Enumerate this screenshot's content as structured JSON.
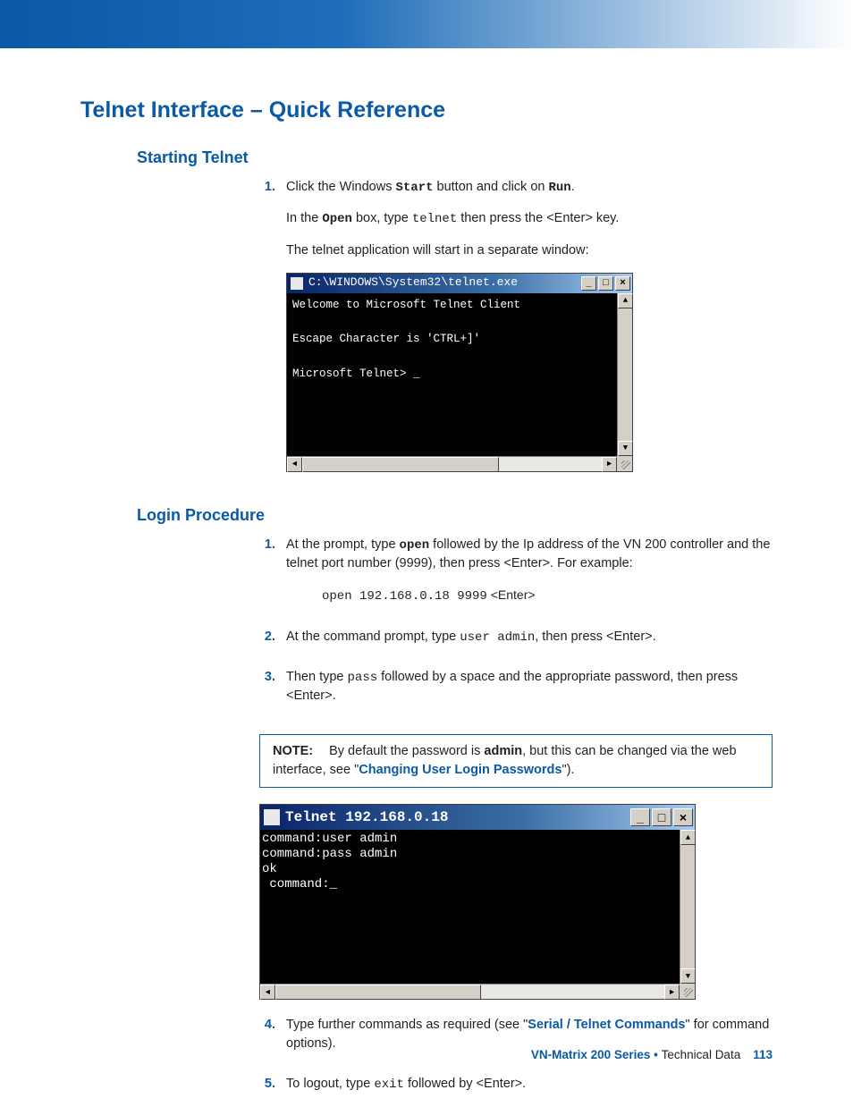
{
  "h1": "Telnet Interface – Quick Reference",
  "sec1": {
    "heading": "Starting Telnet",
    "step1": {
      "num": "1.",
      "t1": "Click the Windows ",
      "start": "Start",
      "t2": " button and click on ",
      "run": "Run",
      "t3": ".",
      "p2a": "In the ",
      "open": "Open",
      "p2b": " box, type ",
      "telnet": "telnet",
      "p2c": " then press the <Enter> key.",
      "p3": "The telnet application will start in a separate window:"
    }
  },
  "console1": {
    "title": "C:\\WINDOWS\\System32\\telnet.exe",
    "body": "Welcome to Microsoft Telnet Client\n\nEscape Character is 'CTRL+]'\n\nMicrosoft Telnet> _\n\n\n\n\n"
  },
  "sec2": {
    "heading": "Login Procedure",
    "s1": {
      "num": "1.",
      "a": "At the prompt, type ",
      "open": "open",
      "b": " followed by the Ip address of the VN 200 controller and the telnet port number (9999), then press <Enter>. For example:",
      "code": "open 192.168.0.18 9999",
      "enter": " <Enter>"
    },
    "s2": {
      "num": "2.",
      "a": "At the command prompt, type ",
      "cmd": "user admin",
      "b": ", then press <Enter>."
    },
    "s3": {
      "num": "3.",
      "a": "Then type ",
      "pass": "pass",
      "b": " followed by a space and the appropriate password, then press <Enter>."
    },
    "note": {
      "label": "NOTE:",
      "a": "By default the password is ",
      "admin": "admin",
      "b": ", but this can be changed via the web interface, see \"",
      "link": "Changing User Login Passwords",
      "c": "\")."
    },
    "s4": {
      "num": "4.",
      "a": "Type further commands as required (see \"",
      "link": "Serial / Telnet Commands",
      "b": "\" for command options)."
    },
    "s5": {
      "num": "5.",
      "a": "To logout, type ",
      "exit": "exit",
      "b": " followed by <Enter>."
    }
  },
  "console2": {
    "title": "Telnet 192.168.0.18",
    "body": "command:user admin\ncommand:pass admin\nok\n command:_\n\n\n\n\n\n\n"
  },
  "footer": {
    "product": "VN-Matrix 200 Series",
    "bullet": "  •  ",
    "section": "Technical Data",
    "page": "113"
  },
  "winbtns": {
    "min": "_",
    "max": "□",
    "close": "×"
  },
  "arrows": {
    "up": "▲",
    "down": "▼",
    "left": "◄",
    "right": "►"
  }
}
